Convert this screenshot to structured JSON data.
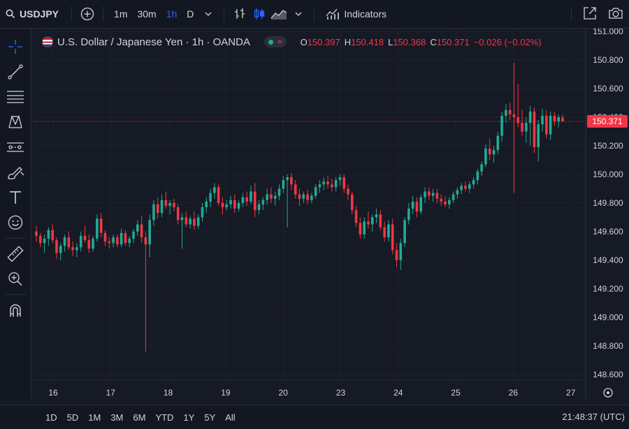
{
  "toolbar": {
    "symbol": "USDJPY",
    "intervals": [
      "1m",
      "30m",
      "1h",
      "D"
    ],
    "active_interval": "1h",
    "indicators_label": "Indicators"
  },
  "legend": {
    "title": "U.S. Dollar / Japanese Yen · 1h · OANDA",
    "open_label": "O",
    "open": "150.397",
    "high_label": "H",
    "high": "150.418",
    "low_label": "L",
    "low": "150.368",
    "close_label": "C",
    "close": "150.371",
    "change": "−0.026 (−0.02%)"
  },
  "price_axis": {
    "ticks": [
      "151.000",
      "150.800",
      "150.600",
      "150.400",
      "150.200",
      "150.000",
      "149.800",
      "149.600",
      "149.400",
      "149.200",
      "149.000",
      "148.800",
      "148.600"
    ],
    "current_price": "150.371"
  },
  "time_axis": {
    "labels": [
      "16",
      "17",
      "18",
      "19",
      "20",
      "23",
      "24",
      "25",
      "26",
      "27"
    ]
  },
  "bottom": {
    "ranges": [
      "1D",
      "5D",
      "1M",
      "3M",
      "6M",
      "YTD",
      "1Y",
      "5Y",
      "All"
    ],
    "clock": "21:48:37 (UTC)"
  },
  "colors": {
    "up": "#22ab94",
    "down": "#f23645",
    "accent": "#2962ff",
    "background": "#161a25",
    "grid": "#1e222d",
    "text": "#d1d4dc"
  },
  "icons": {
    "left_toolbar": [
      "crosshair-icon",
      "trend-line-icon",
      "fib-retracement-icon",
      "pattern-icon",
      "forecast-icon",
      "brush-icon",
      "text-icon",
      "emoji-icon",
      "ruler-icon",
      "zoom-in-icon",
      "magnet-icon"
    ],
    "top_right": [
      "fullscreen-icon",
      "camera-icon"
    ]
  },
  "chart_data": {
    "type": "candlestick",
    "instrument": "USDJPY",
    "interval": "1h",
    "ylim": [
      148.56,
      151.02
    ],
    "x_tick_labels": [
      "16",
      "17",
      "18",
      "19",
      "20",
      "23",
      "24",
      "25",
      "26",
      "27"
    ],
    "last_price": 150.371,
    "candles": [
      [
        149.6,
        149.64,
        149.53,
        149.57
      ],
      [
        149.57,
        149.59,
        149.49,
        149.52
      ],
      [
        149.52,
        149.58,
        149.45,
        149.55
      ],
      [
        149.55,
        149.63,
        149.5,
        149.61
      ],
      [
        149.61,
        149.65,
        149.52,
        149.54
      ],
      [
        149.54,
        149.56,
        149.41,
        149.45
      ],
      [
        149.45,
        149.52,
        149.4,
        149.5
      ],
      [
        149.5,
        149.58,
        149.46,
        149.56
      ],
      [
        149.56,
        149.6,
        149.47,
        149.49
      ],
      [
        149.49,
        149.53,
        149.43,
        149.47
      ],
      [
        149.47,
        149.52,
        149.42,
        149.49
      ],
      [
        149.49,
        149.6,
        149.46,
        149.57
      ],
      [
        149.57,
        149.64,
        149.52,
        149.54
      ],
      [
        149.54,
        149.58,
        149.45,
        149.48
      ],
      [
        149.48,
        149.57,
        149.46,
        149.55
      ],
      [
        149.55,
        149.72,
        149.53,
        149.69
      ],
      [
        149.69,
        149.73,
        149.56,
        149.59
      ],
      [
        149.59,
        149.61,
        149.5,
        149.53
      ],
      [
        149.53,
        149.56,
        149.48,
        149.52
      ],
      [
        149.52,
        149.58,
        149.49,
        149.56
      ],
      [
        149.56,
        149.58,
        149.49,
        149.51
      ],
      [
        149.51,
        149.62,
        149.49,
        149.59
      ],
      [
        149.59,
        149.61,
        149.5,
        149.52
      ],
      [
        149.52,
        149.57,
        149.49,
        149.55
      ],
      [
        149.55,
        149.62,
        149.52,
        149.6
      ],
      [
        149.6,
        149.68,
        149.57,
        149.65
      ],
      [
        149.65,
        149.71,
        149.52,
        149.56
      ],
      [
        149.56,
        149.6,
        148.76,
        149.51
      ],
      [
        149.51,
        149.72,
        149.42,
        149.68
      ],
      [
        149.68,
        149.82,
        149.64,
        149.79
      ],
      [
        149.79,
        149.84,
        149.69,
        149.73
      ],
      [
        149.73,
        149.86,
        149.7,
        149.82
      ],
      [
        149.82,
        149.88,
        149.76,
        149.78
      ],
      [
        149.78,
        149.82,
        149.72,
        149.8
      ],
      [
        149.8,
        149.83,
        149.74,
        149.77
      ],
      [
        149.77,
        149.79,
        149.65,
        149.68
      ],
      [
        149.68,
        149.73,
        149.48,
        149.7
      ],
      [
        149.7,
        149.74,
        149.63,
        149.65
      ],
      [
        149.65,
        149.71,
        149.62,
        149.69
      ],
      [
        149.69,
        149.74,
        149.61,
        149.64
      ],
      [
        149.64,
        149.72,
        149.62,
        149.7
      ],
      [
        149.7,
        149.8,
        149.67,
        149.77
      ],
      [
        149.77,
        149.84,
        149.73,
        149.81
      ],
      [
        149.81,
        149.9,
        149.77,
        149.87
      ],
      [
        149.87,
        149.94,
        149.83,
        149.91
      ],
      [
        149.91,
        149.93,
        149.78,
        149.8
      ],
      [
        149.8,
        149.84,
        149.72,
        149.77
      ],
      [
        149.77,
        149.82,
        149.75,
        149.79
      ],
      [
        149.79,
        149.85,
        149.76,
        149.82
      ],
      [
        149.82,
        149.86,
        149.73,
        149.76
      ],
      [
        149.76,
        149.82,
        149.74,
        149.8
      ],
      [
        149.8,
        149.87,
        149.77,
        149.84
      ],
      [
        149.84,
        149.88,
        149.78,
        149.81
      ],
      [
        149.81,
        149.92,
        149.79,
        149.88
      ],
      [
        149.88,
        149.94,
        149.7,
        149.75
      ],
      [
        149.75,
        149.82,
        149.72,
        149.79
      ],
      [
        149.79,
        149.84,
        149.75,
        149.82
      ],
      [
        149.82,
        149.9,
        149.79,
        149.86
      ],
      [
        149.86,
        149.91,
        149.8,
        149.83
      ],
      [
        149.83,
        149.88,
        149.78,
        149.85
      ],
      [
        149.85,
        149.93,
        149.82,
        149.9
      ],
      [
        149.9,
        149.99,
        149.87,
        149.96
      ],
      [
        149.96,
        150.0,
        149.63,
        149.98
      ],
      [
        149.98,
        150.01,
        149.89,
        149.93
      ],
      [
        149.93,
        149.96,
        149.83,
        149.86
      ],
      [
        149.86,
        149.9,
        149.78,
        149.83
      ],
      [
        149.83,
        149.88,
        149.8,
        149.86
      ],
      [
        149.86,
        149.89,
        149.79,
        149.82
      ],
      [
        149.82,
        149.87,
        149.8,
        149.85
      ],
      [
        149.85,
        149.93,
        149.83,
        149.91
      ],
      [
        149.91,
        149.96,
        149.87,
        149.93
      ],
      [
        149.93,
        149.98,
        149.89,
        149.95
      ],
      [
        149.95,
        149.99,
        149.9,
        149.93
      ],
      [
        149.93,
        149.97,
        149.88,
        149.91
      ],
      [
        149.91,
        149.98,
        149.88,
        149.96
      ],
      [
        149.96,
        150.0,
        149.92,
        149.98
      ],
      [
        149.98,
        150.0,
        149.87,
        149.9
      ],
      [
        149.9,
        149.93,
        149.82,
        149.86
      ],
      [
        149.86,
        149.88,
        149.72,
        149.75
      ],
      [
        149.75,
        149.78,
        149.63,
        149.66
      ],
      [
        149.66,
        149.7,
        149.55,
        149.58
      ],
      [
        149.58,
        149.7,
        149.55,
        149.67
      ],
      [
        149.67,
        149.74,
        149.62,
        149.65
      ],
      [
        149.65,
        149.72,
        149.6,
        149.7
      ],
      [
        149.7,
        149.76,
        149.66,
        149.72
      ],
      [
        149.72,
        149.75,
        149.61,
        149.63
      ],
      [
        149.63,
        149.67,
        149.53,
        149.56
      ],
      [
        149.56,
        149.68,
        149.53,
        149.65
      ],
      [
        149.65,
        149.69,
        149.44,
        149.47
      ],
      [
        149.47,
        149.52,
        149.35,
        149.4
      ],
      [
        149.4,
        149.55,
        149.33,
        149.52
      ],
      [
        149.52,
        149.7,
        149.49,
        149.68
      ],
      [
        149.68,
        149.8,
        149.65,
        149.76
      ],
      [
        149.76,
        149.85,
        149.72,
        149.81
      ],
      [
        149.81,
        149.84,
        149.7,
        149.74
      ],
      [
        149.74,
        149.86,
        149.72,
        149.84
      ],
      [
        149.84,
        149.91,
        149.8,
        149.88
      ],
      [
        149.88,
        149.91,
        149.82,
        149.85
      ],
      [
        149.85,
        149.9,
        149.81,
        149.87
      ],
      [
        149.87,
        149.9,
        149.8,
        149.83
      ],
      [
        149.83,
        149.86,
        149.78,
        149.81
      ],
      [
        149.81,
        149.85,
        149.77,
        149.79
      ],
      [
        149.79,
        149.84,
        149.76,
        149.82
      ],
      [
        149.82,
        149.88,
        149.8,
        149.86
      ],
      [
        149.86,
        149.91,
        149.83,
        149.89
      ],
      [
        149.89,
        149.94,
        149.86,
        149.92
      ],
      [
        149.92,
        149.95,
        149.88,
        149.9
      ],
      [
        149.9,
        149.95,
        149.87,
        149.93
      ],
      [
        149.93,
        149.98,
        149.9,
        149.96
      ],
      [
        149.96,
        150.04,
        149.93,
        150.02
      ],
      [
        150.02,
        150.09,
        149.99,
        150.07
      ],
      [
        150.07,
        150.21,
        150.05,
        150.18
      ],
      [
        150.18,
        150.25,
        150.1,
        150.14
      ],
      [
        150.14,
        150.2,
        150.08,
        150.17
      ],
      [
        150.17,
        150.3,
        150.14,
        150.27
      ],
      [
        150.27,
        150.44,
        150.23,
        150.41
      ],
      [
        150.41,
        150.49,
        150.36,
        150.45
      ],
      [
        150.45,
        150.5,
        150.38,
        150.42
      ],
      [
        150.42,
        150.78,
        149.87,
        150.4
      ],
      [
        150.4,
        150.63,
        150.33,
        150.36
      ],
      [
        150.36,
        150.45,
        150.27,
        150.3
      ],
      [
        150.3,
        150.4,
        150.22,
        150.36
      ],
      [
        150.36,
        150.48,
        150.2,
        150.44
      ],
      [
        150.44,
        150.47,
        150.15,
        150.19
      ],
      [
        150.19,
        150.38,
        150.09,
        150.35
      ],
      [
        150.35,
        150.46,
        150.3,
        150.41
      ],
      [
        150.41,
        150.45,
        150.25,
        150.28
      ],
      [
        150.28,
        150.44,
        150.24,
        150.41
      ],
      [
        150.41,
        150.44,
        150.34,
        150.37
      ],
      [
        150.37,
        150.42,
        150.33,
        150.4
      ],
      [
        150.397,
        150.418,
        150.368,
        150.371
      ]
    ]
  }
}
